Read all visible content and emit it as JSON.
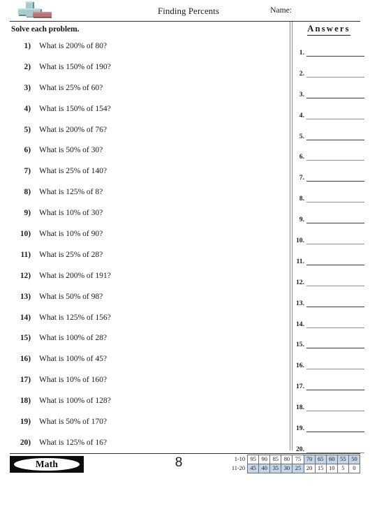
{
  "header": {
    "title": "Finding Percents",
    "name_label": "Name:",
    "logo_icon": "plus-minus-icon",
    "logo_plus_color": "#9ec6ca",
    "logo_minus_color": "#b5767a"
  },
  "instruction": "Solve each problem.",
  "problems": [
    {
      "num": "1)",
      "text": "What is 200% of 80?"
    },
    {
      "num": "2)",
      "text": "What is 150% of 190?"
    },
    {
      "num": "3)",
      "text": "What is 25% of 60?"
    },
    {
      "num": "4)",
      "text": "What is 150% of 154?"
    },
    {
      "num": "5)",
      "text": "What is 200% of 76?"
    },
    {
      "num": "6)",
      "text": "What is 50% of 30?"
    },
    {
      "num": "7)",
      "text": "What is 25% of 140?"
    },
    {
      "num": "8)",
      "text": "What is 125% of 8?"
    },
    {
      "num": "9)",
      "text": "What is 10% of 30?"
    },
    {
      "num": "10)",
      "text": "What is 10% of 90?"
    },
    {
      "num": "11)",
      "text": "What is 25% of 28?"
    },
    {
      "num": "12)",
      "text": "What is 200% of 191?"
    },
    {
      "num": "13)",
      "text": "What is 50% of 98?"
    },
    {
      "num": "14)",
      "text": "What is 125% of 156?"
    },
    {
      "num": "15)",
      "text": "What is 100% of 28?"
    },
    {
      "num": "16)",
      "text": "What is 100% of 45?"
    },
    {
      "num": "17)",
      "text": "What is 10% of 160?"
    },
    {
      "num": "18)",
      "text": "What is 100% of 128?"
    },
    {
      "num": "19)",
      "text": "What is 50% of 170?"
    },
    {
      "num": "20)",
      "text": "What is 125% of 16?"
    }
  ],
  "answers": {
    "title": "Answers",
    "rows": [
      {
        "num": "1.",
        "value": ""
      },
      {
        "num": "2.",
        "value": ""
      },
      {
        "num": "3.",
        "value": ""
      },
      {
        "num": "4.",
        "value": ""
      },
      {
        "num": "5.",
        "value": ""
      },
      {
        "num": "6.",
        "value": ""
      },
      {
        "num": "7.",
        "value": ""
      },
      {
        "num": "8.",
        "value": ""
      },
      {
        "num": "9.",
        "value": ""
      },
      {
        "num": "10.",
        "value": ""
      },
      {
        "num": "11.",
        "value": ""
      },
      {
        "num": "12.",
        "value": ""
      },
      {
        "num": "13.",
        "value": ""
      },
      {
        "num": "14.",
        "value": ""
      },
      {
        "num": "15.",
        "value": ""
      },
      {
        "num": "16.",
        "value": ""
      },
      {
        "num": "17.",
        "value": ""
      },
      {
        "num": "18.",
        "value": ""
      },
      {
        "num": "19.",
        "value": ""
      },
      {
        "num": "20.",
        "value": ""
      }
    ]
  },
  "footer": {
    "subject_badge": "Math",
    "page_number": "8"
  },
  "score_table": {
    "shade_color": "#c3d5e8",
    "rows": [
      {
        "label": "1-10",
        "cells": [
          {
            "value": "95",
            "shaded": false
          },
          {
            "value": "90",
            "shaded": false
          },
          {
            "value": "85",
            "shaded": false
          },
          {
            "value": "80",
            "shaded": false
          },
          {
            "value": "75",
            "shaded": false
          },
          {
            "value": "70",
            "shaded": true
          },
          {
            "value": "65",
            "shaded": true
          },
          {
            "value": "60",
            "shaded": true
          },
          {
            "value": "55",
            "shaded": true
          },
          {
            "value": "50",
            "shaded": true
          }
        ]
      },
      {
        "label": "11-20",
        "cells": [
          {
            "value": "45",
            "shaded": true
          },
          {
            "value": "40",
            "shaded": true
          },
          {
            "value": "35",
            "shaded": true
          },
          {
            "value": "30",
            "shaded": true
          },
          {
            "value": "25",
            "shaded": true
          },
          {
            "value": "20",
            "shaded": false
          },
          {
            "value": "15",
            "shaded": false
          },
          {
            "value": "10",
            "shaded": false
          },
          {
            "value": "5",
            "shaded": false
          },
          {
            "value": "0",
            "shaded": false
          }
        ]
      }
    ]
  }
}
